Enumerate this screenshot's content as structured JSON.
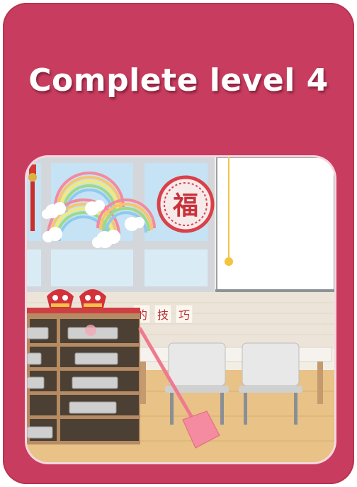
{
  "title": "Complete level 4",
  "banner_chars": [
    "的",
    "技",
    "巧"
  ],
  "fu_char": "福",
  "colors": {
    "card": "#c83d5f",
    "sky": "#bfe0f4",
    "frame": "#cfd3d8",
    "cabinet": "#b48862",
    "floor": "#e9c48a",
    "broom": "#f07c93"
  }
}
